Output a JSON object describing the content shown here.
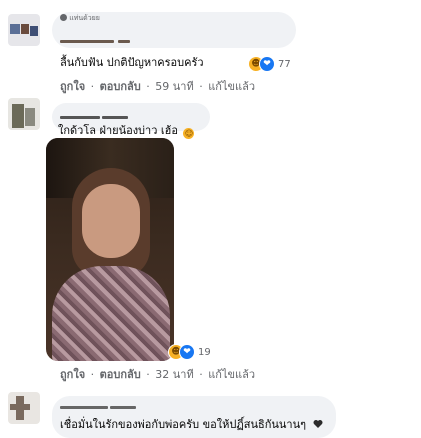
{
  "comments": [
    {
      "top_label": "แท่นด้วยย",
      "text": "ลื้นกับฟัน ปกติปัญหาครอบครัว",
      "reaction_count": "77",
      "actions": {
        "like": "ถูกใจ",
        "reply": "ตอบกลับ",
        "time": "59 นาที",
        "edited": "แก้ไขแล้ว"
      }
    },
    {
      "text": "ใกด้วโล ฝ่ายน้องบ่าว เฮ้อ",
      "reaction_count": "19",
      "actions": {
        "like": "ถูกใจ",
        "reply": "ตอบกลับ",
        "time": "32 นาที",
        "edited": "แก้ไขแล้ว"
      }
    },
    {
      "text": "เชื่อมั่นในรักของพ่อกับพ่อครับ ขอให้ปฏิ์สนธิกันนานๆ"
    }
  ],
  "separator": "·",
  "icons": {
    "top_badge": "globe-icon",
    "reaction_haha": "haha-reaction-icon",
    "reaction_like": "like-reaction-icon",
    "heart": "black-heart-icon",
    "laugh_emoji": "laughing-emoji-icon"
  },
  "colors": {
    "bubble": "#f0f2f5",
    "meta_text": "#65676b",
    "like_blue": "#1877f2",
    "haha_yellow": "#f7b125"
  }
}
